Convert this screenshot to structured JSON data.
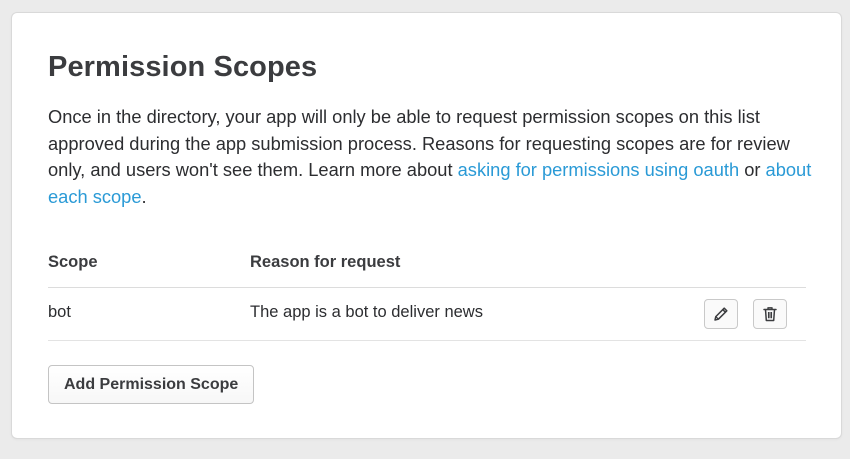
{
  "section": {
    "title": "Permission Scopes",
    "description_before": "Once in the directory, your app will only be able to request permission scopes on this list approved during the app submission process. Reasons for requesting scopes are for review only, and users won't see them. Learn more about ",
    "link_oauth": "asking for permissions using oauth",
    "description_middle": " or ",
    "link_scopes": "about each scope",
    "description_after": ".",
    "link_color": "#2a9ad6"
  },
  "table": {
    "headers": {
      "scope": "Scope",
      "reason": "Reason for request"
    },
    "rows": [
      {
        "scope": "bot",
        "reason": "The app is a bot to deliver news",
        "actions": [
          "pencil-icon",
          "trash-icon"
        ]
      }
    ]
  },
  "actions": {
    "add_label": "Add Permission Scope"
  }
}
